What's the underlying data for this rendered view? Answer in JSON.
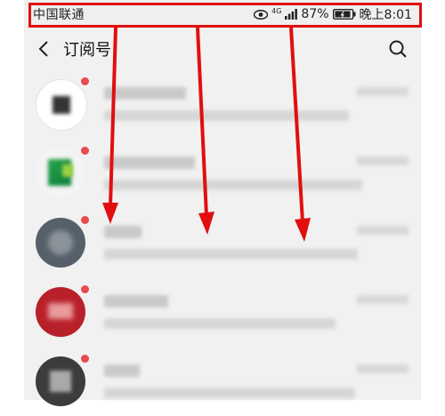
{
  "status_bar": {
    "carrier": "中国联通",
    "network": "4G",
    "battery": "87%",
    "time": "晚上8:01",
    "icons": [
      "eye-icon",
      "signal-icon",
      "battery-icon"
    ]
  },
  "header": {
    "title": "订阅号",
    "back_icon": "chevron-left-icon",
    "search_icon": "search-icon"
  },
  "colors": {
    "annotation": "#e10f0f",
    "unread_dot": "#e84a4a",
    "background": "#f1f1f1"
  },
  "list": {
    "items": [
      {
        "avatar": "dark-square-avatar"
      },
      {
        "avatar": "green-logo-avatar"
      },
      {
        "avatar": "gray-photo-avatar"
      },
      {
        "avatar": "red-logo-avatar"
      },
      {
        "avatar": "dark-square-avatar-2"
      }
    ]
  }
}
